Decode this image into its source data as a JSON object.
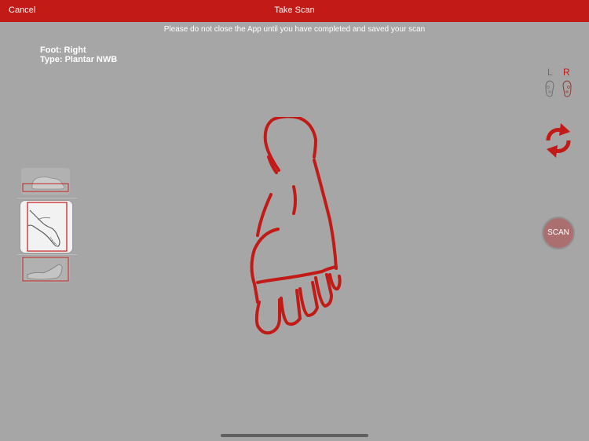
{
  "header": {
    "cancel_label": "Cancel",
    "title": "Take Scan"
  },
  "notice": "Please do not close the App until you have completed and saved your scan",
  "scan_info": {
    "foot": "Foot: Right",
    "type": "Type: Plantar NWB"
  },
  "side_selector": {
    "left_label": "L",
    "right_label": "R",
    "selected": "R"
  },
  "scan_button_label": "SCAN",
  "view_thumbnails": {
    "selected_index": 1,
    "icons": [
      "foot-top-view-icon",
      "foot-side-view-icon",
      "foot-lateral-view-icon"
    ]
  },
  "colors": {
    "header": "#c21b17",
    "accent": "#c21b17",
    "background": "#a6a6a6",
    "inactive": "#6d6d6d"
  }
}
